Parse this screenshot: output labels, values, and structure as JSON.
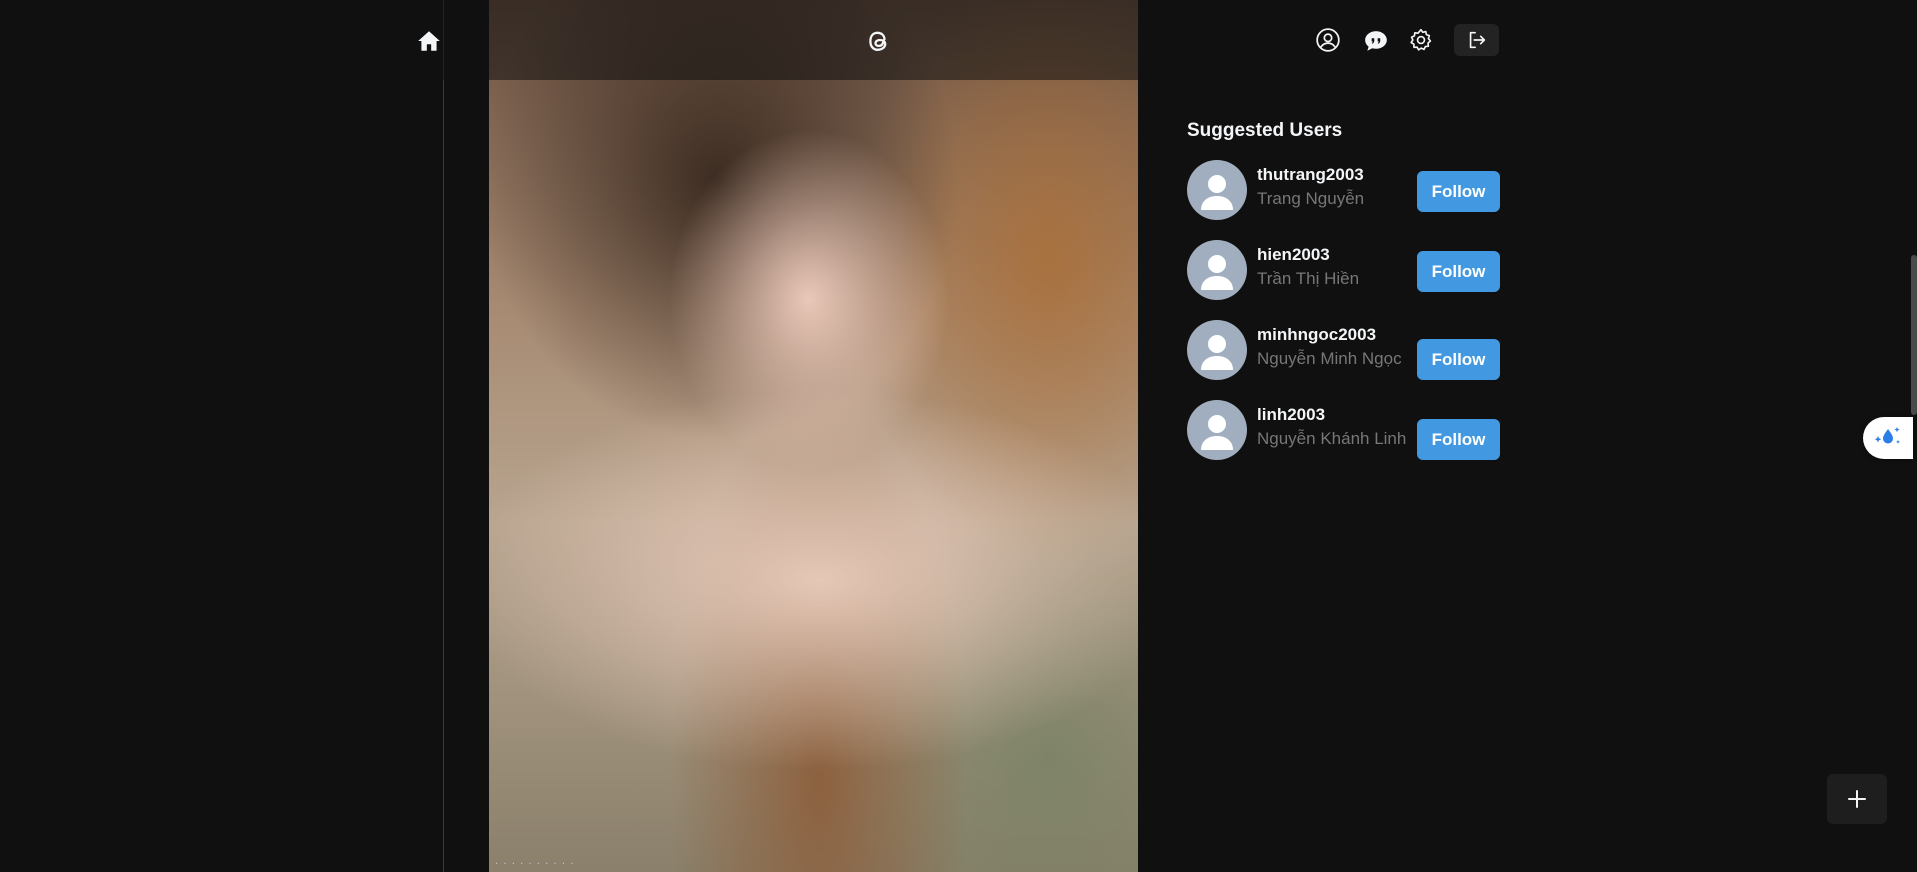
{
  "nav": {
    "home_icon": "home-icon",
    "logo_icon": "threads-logo-icon",
    "profile_icon": "user-circle-icon",
    "chat_icon": "chat-bubbles-icon",
    "settings_icon": "gear-icon",
    "logout_icon": "logout-icon"
  },
  "post": {
    "photo_icon": "portrait-photo",
    "watermark": "· · · · · · · ·  · ·"
  },
  "suggested": {
    "title": "Suggested Users",
    "users": [
      {
        "username": "thutrang2003",
        "fullname": "Trang Nguyễn",
        "action": "Follow"
      },
      {
        "username": "hien2003",
        "fullname": "Trần Thị Hiền",
        "action": "Follow"
      },
      {
        "username": "minhngoc2003",
        "fullname": "Nguyễn Minh Ngọc",
        "action": "Follow"
      },
      {
        "username": "linh2003",
        "fullname": "Nguyễn Khánh Linh",
        "action": "Follow"
      }
    ]
  },
  "widgets": {
    "side_widget_icon": "sparkle-drop-icon",
    "create_icon": "plus-icon"
  },
  "colors": {
    "background": "#101010",
    "accent": "#4299e1",
    "muted_text": "#777777",
    "avatar_bg": "#a0aec0"
  }
}
